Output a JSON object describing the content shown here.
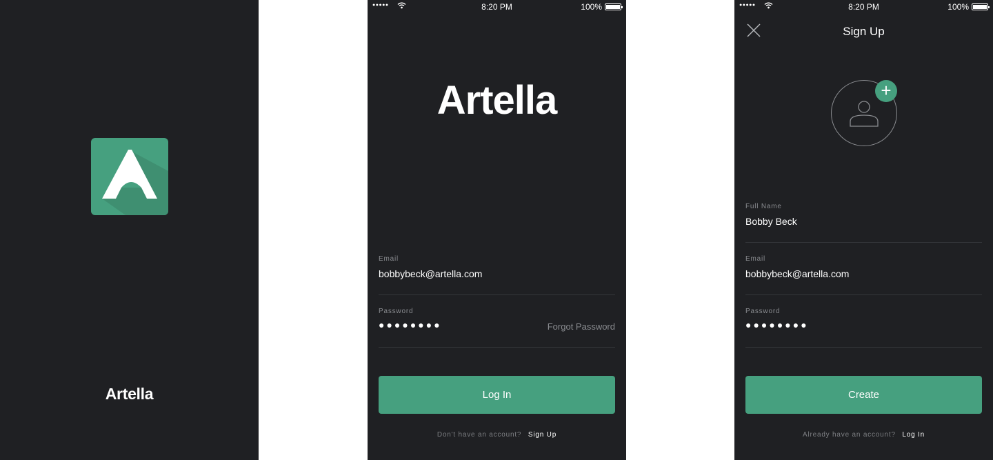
{
  "colors": {
    "background": "#1f2023",
    "accent": "#46a07f",
    "muted": "#8a8c90",
    "divider": "#34363a"
  },
  "splash": {
    "brand": "Artella",
    "icon": "artella-a-icon"
  },
  "status_bar": {
    "signal": "●●●●●",
    "time": "8:20 PM",
    "battery": "100%"
  },
  "login": {
    "logo": "Artella",
    "email": {
      "label": "Email",
      "value": "bobbybeck@artella.com"
    },
    "password": {
      "label": "Password",
      "value": "●●●●●●●●",
      "forgot": "Forgot Password"
    },
    "submit": "Log In",
    "footer": {
      "prompt": "Don't have an account?",
      "action": "Sign Up"
    }
  },
  "signup": {
    "title": "Sign Up",
    "close_icon": "close-icon",
    "add_photo": "+",
    "full_name": {
      "label": "Full Name",
      "value": "Bobby Beck"
    },
    "email": {
      "label": "Email",
      "value": "bobbybeck@artella.com"
    },
    "password": {
      "label": "Password",
      "value": "●●●●●●●●"
    },
    "submit": "Create",
    "footer": {
      "prompt": "Already have an account?",
      "action": "Log In"
    }
  }
}
